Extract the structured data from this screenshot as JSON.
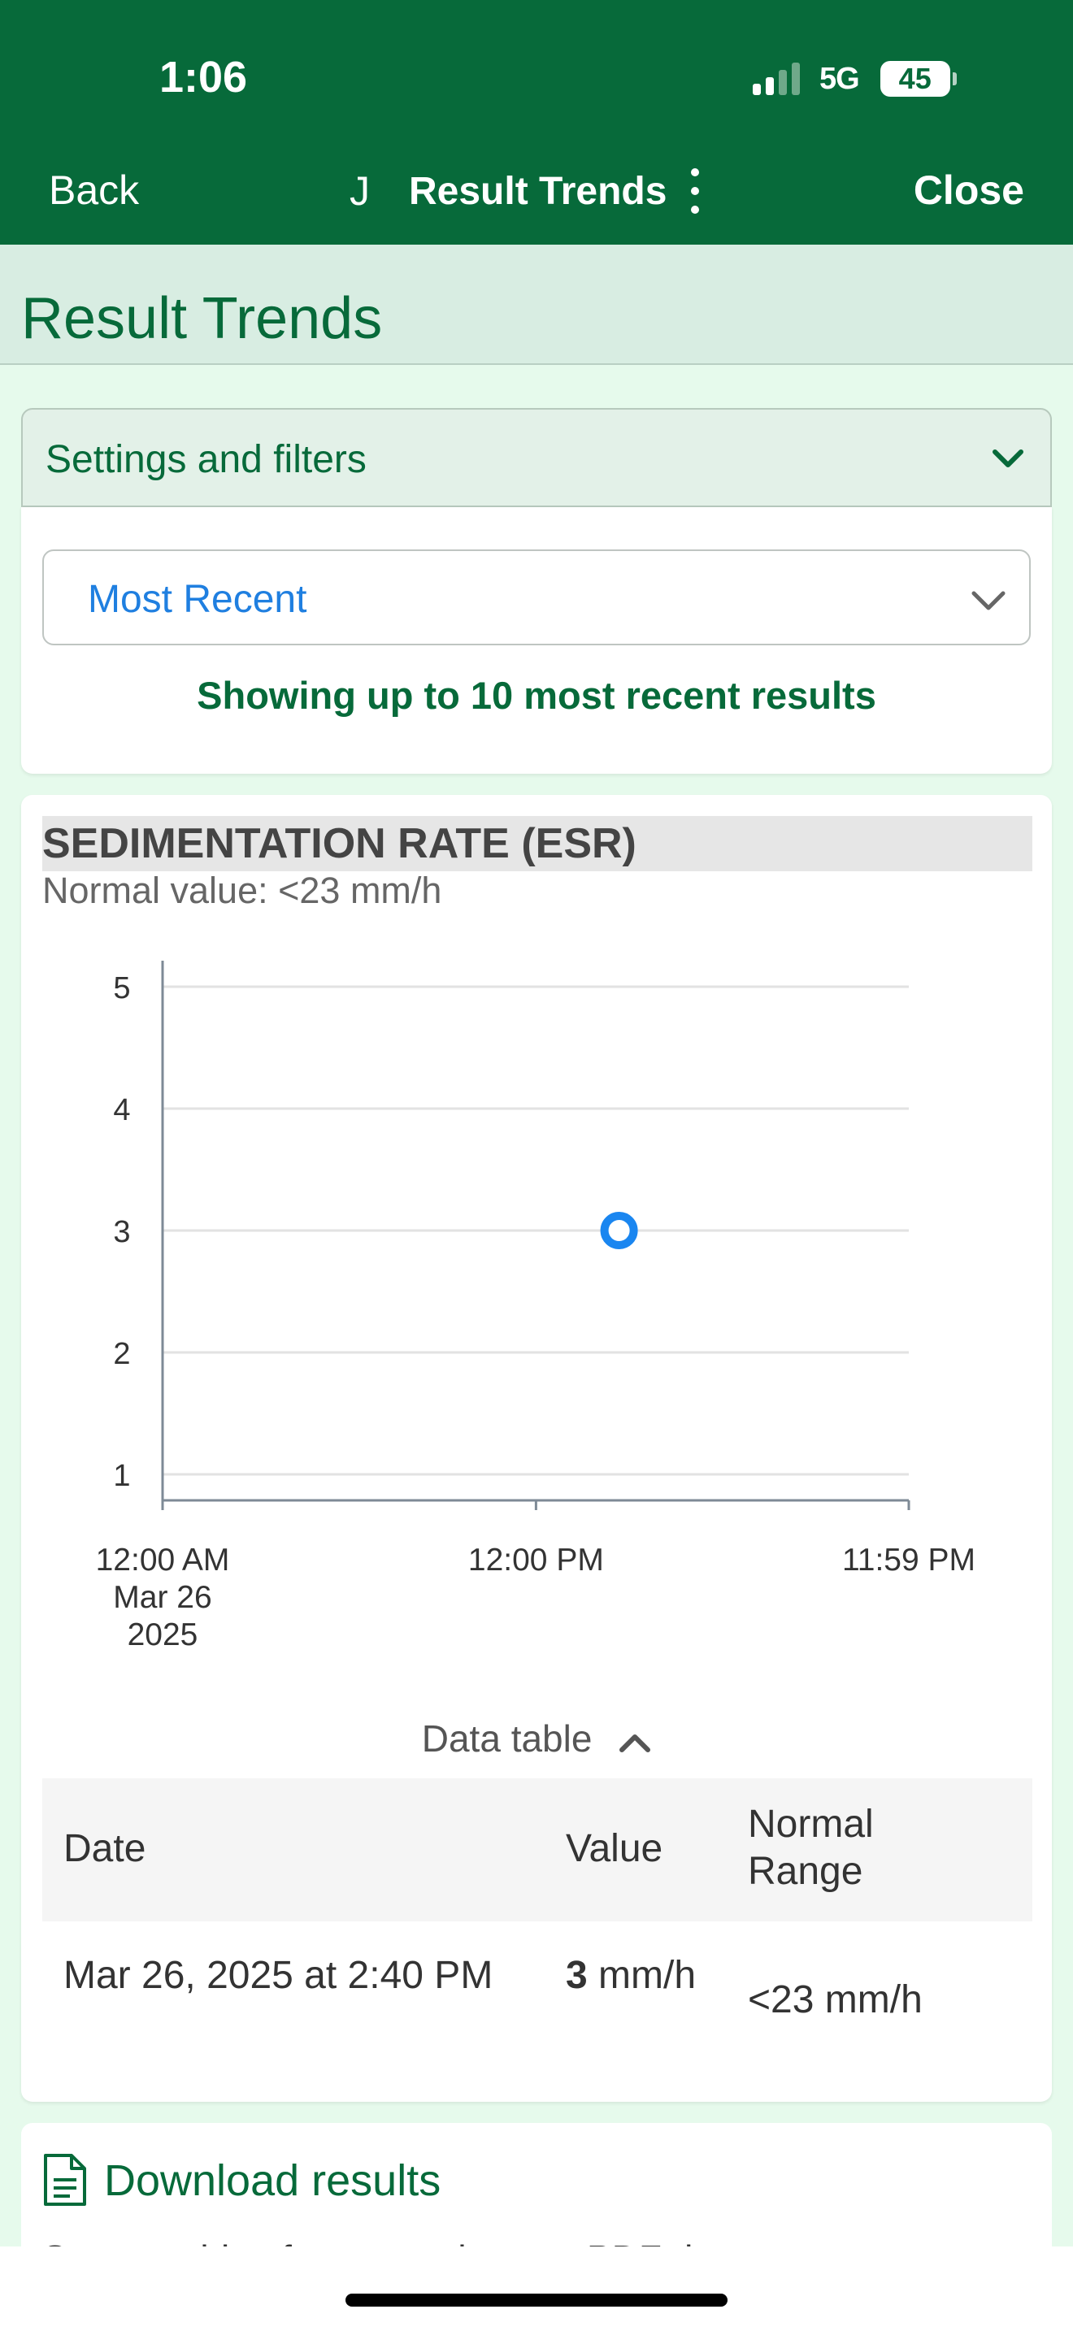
{
  "status_bar": {
    "time": "1:06",
    "network": "5G",
    "battery": "45"
  },
  "nav": {
    "back_label": "Back",
    "initial": "J",
    "title": "Result Trends",
    "close_label": "Close"
  },
  "page_title": "Result Trends",
  "settings": {
    "label": "Settings and filters",
    "select_value": "Most Recent",
    "showing_text": "Showing up to 10 most recent results"
  },
  "result": {
    "test_name": "SEDIMENTATION RATE (ESR)",
    "normal_value": "Normal value: <23 mm/h",
    "data_table_label": "Data table",
    "columns": [
      "Date",
      "Value",
      "Normal Range"
    ],
    "rows": [
      {
        "date": "Mar 26, 2025 at 2:40 PM",
        "value": "3",
        "unit": "mm/h",
        "range": "<23 mm/h"
      }
    ]
  },
  "chart_data": {
    "type": "scatter",
    "title": "",
    "xlabel": "",
    "ylabel": "",
    "ylim": [
      1,
      5
    ],
    "yticks": [
      1,
      2,
      3,
      4,
      5
    ],
    "x_ticks": [
      {
        "hour": 0,
        "label_lines": [
          "12:00 AM",
          "Mar 26",
          "2025"
        ]
      },
      {
        "hour": 12,
        "label_lines": [
          "12:00 PM"
        ]
      },
      {
        "hour": 23.98,
        "label_lines": [
          "11:59 PM"
        ]
      }
    ],
    "xlim": [
      0,
      23.98
    ],
    "points": [
      {
        "hour": 14.67,
        "y": 3
      }
    ],
    "grid": true,
    "point_color": "#1a86f0"
  },
  "download": {
    "label": "Download results",
    "description": "Save a table of your results as a PDF document."
  },
  "colors": {
    "brand_green": "#076a3a",
    "link_blue": "#1f7fe0"
  }
}
